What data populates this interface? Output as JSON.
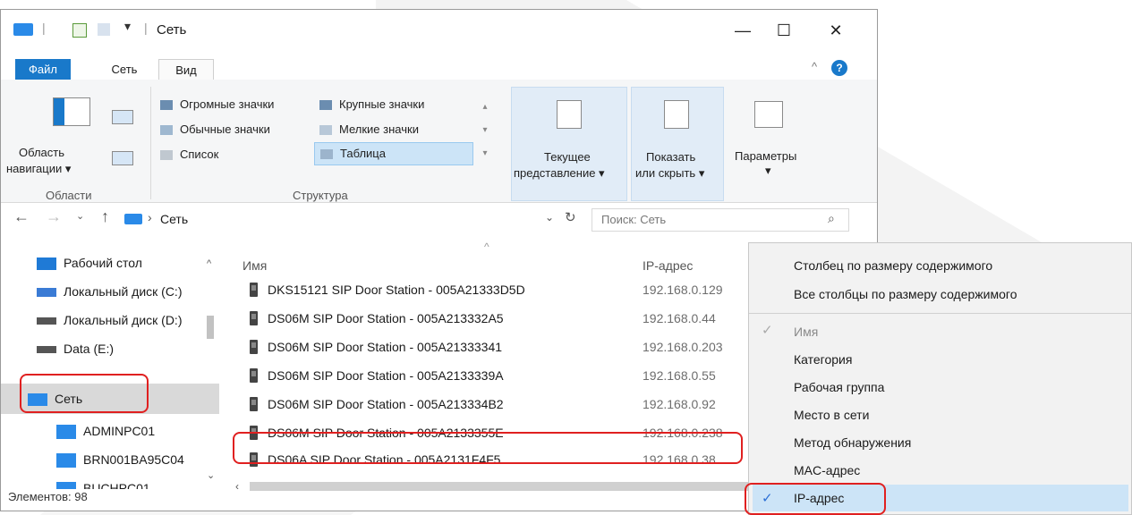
{
  "window": {
    "title": "Сеть"
  },
  "title_buttons": {
    "minimize": "—",
    "maximize": "☐",
    "close": "✕"
  },
  "tabs": [
    {
      "label": "Файл"
    },
    {
      "label": "Сеть"
    },
    {
      "label": "Вид"
    }
  ],
  "ribbon": {
    "nav_pane": {
      "line1": "Область",
      "line2": "навигации ▾"
    },
    "group_areas": "Области",
    "layouts": [
      "Огромные значки",
      "Крупные значки",
      "Обычные значки",
      "Мелкие значки",
      "Список",
      "Таблица"
    ],
    "group_structure": "Структура",
    "current_view": {
      "line1": "Текущее",
      "line2": "представление ▾"
    },
    "show_hide": {
      "line1": "Показать",
      "line2": "или скрыть ▾"
    },
    "params": {
      "line1": "Параметры",
      "line2": "▾"
    }
  },
  "address": {
    "crumb": "Сеть",
    "search_placeholder": "Поиск: Сеть"
  },
  "nav_items": [
    {
      "label": "Рабочий стол",
      "color": "#1f7ad6"
    },
    {
      "label": "Локальный диск (C:)",
      "color": "#3a7bd5"
    },
    {
      "label": "Локальный диск (D:)",
      "color": "#555555"
    },
    {
      "label": "Data (E:)",
      "color": "#555555"
    },
    {
      "label": "Сеть",
      "color": "#2a8ae8"
    },
    {
      "label": "ADMINPC01",
      "color": "#2a8ae8"
    },
    {
      "label": "BRN001BA95C04",
      "color": "#2a8ae8"
    },
    {
      "label": "BUCHPC01",
      "color": "#2a8ae8"
    }
  ],
  "columns": {
    "name": "Имя",
    "ip": "IP-адрес"
  },
  "rows": [
    {
      "name": "DKS15121 SIP Door Station - 005A21333D5D",
      "ip": "192.168.0.129"
    },
    {
      "name": "DS06M SIP Door Station - 005A213332A5",
      "ip": "192.168.0.44"
    },
    {
      "name": "DS06M SIP Door Station - 005A21333341",
      "ip": "192.168.0.203"
    },
    {
      "name": "DS06M SIP Door Station - 005A2133339A",
      "ip": "192.168.0.55"
    },
    {
      "name": "DS06M SIP Door Station - 005A213334B2",
      "ip": "192.168.0.92"
    },
    {
      "name": "DS06M SIP Door Station - 005A2133355E",
      "ip": "192.168.0.238"
    },
    {
      "name": "DS06A  SIP Door Station - 005A2131F4F5",
      "ip": "192.168.0.38"
    }
  ],
  "status": "Элементов: 98",
  "context_menu": [
    {
      "label": "Столбец по размеру содержимого"
    },
    {
      "label": "Все столбцы по размеру содержимого"
    },
    {
      "label": "Имя",
      "checked": true,
      "disabled": true
    },
    {
      "label": "Категория"
    },
    {
      "label": "Рабочая группа"
    },
    {
      "label": "Место в сети"
    },
    {
      "label": "Метод обнаружения"
    },
    {
      "label": "MAC-адрес"
    },
    {
      "label": "IP-адрес",
      "checked": true
    }
  ]
}
